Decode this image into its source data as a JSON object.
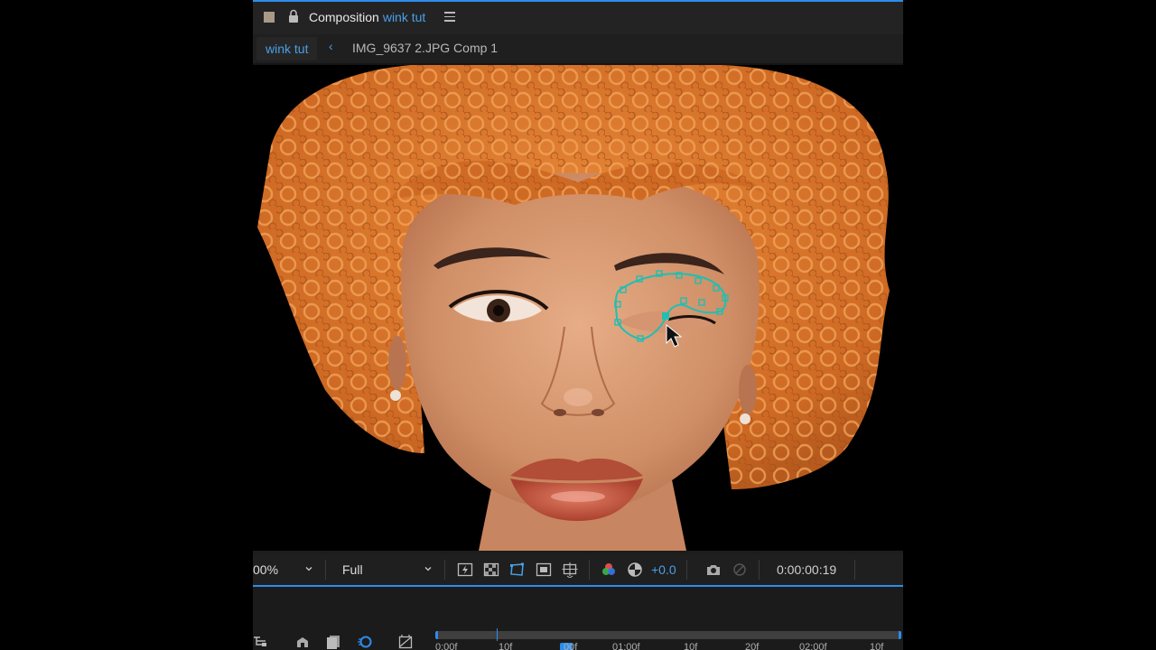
{
  "panel": {
    "label": "Composition",
    "comp_name": "wink tut"
  },
  "breadcrumb": {
    "active": "wink tut",
    "item": "IMG_9637 2.JPG Comp 1"
  },
  "viewer_toolbar": {
    "zoom": "00%",
    "resolution": "Full",
    "exposure": "+0.0",
    "timecode": "0:00:00:19"
  },
  "timeline": {
    "ticks": [
      "0:00f",
      "10f",
      "00f",
      "01:00f",
      "10f",
      "20f",
      "02:00f",
      "10f"
    ]
  },
  "colors": {
    "accent": "#2d8ceb",
    "mask_path": "#1fbfb2",
    "hair": "#d9772e",
    "skin": "#d99c77"
  },
  "icons": [
    "lock-icon",
    "panel-menu-icon",
    "back-chevron-icon",
    "region-of-interest-icon",
    "transparency-grid-icon",
    "mask-visibility-icon",
    "title-safe-icon",
    "guides-icon",
    "color-channels-icon",
    "reset-exposure-icon",
    "snapshot-icon",
    "show-snapshot-icon"
  ]
}
